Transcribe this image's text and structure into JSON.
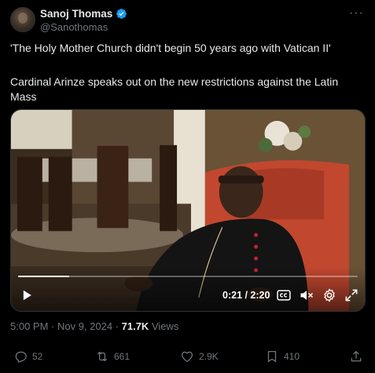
{
  "author": {
    "name": "Sanoj Thomas",
    "handle": "@Sanothomas",
    "verified_color": "#1d9bf0"
  },
  "more_icon": "more-horizontal-icon",
  "tweet": {
    "line1": "'The Holy Mother Church didn't begin 50 years ago with Vatican II'",
    "line2": "Cardinal Arinze speaks out on the new restrictions against the Latin Mass"
  },
  "video": {
    "time": "0:21 / 2:20",
    "progress": 0.15,
    "icons": [
      "play-icon",
      "captions-icon",
      "mute-icon",
      "settings-icon",
      "fullscreen-icon"
    ]
  },
  "meta": {
    "time": "5:00 PM · Nov 9, 2024 · ",
    "views_count": "71.7K",
    "views_label": " Views"
  },
  "actions": {
    "replies": "52",
    "reposts": "661",
    "likes": "2.9K",
    "bookmarks": "410"
  }
}
